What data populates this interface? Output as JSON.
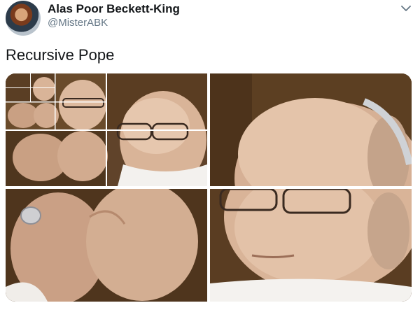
{
  "tweet": {
    "display_name": "Alas Poor Beckett-King",
    "handle": "@MisterABK",
    "text": "Recursive Pope",
    "menu_icon": "chevron-down-icon"
  },
  "media": {
    "layout": "2x2-grid",
    "images": [
      "pope-grid-recursive",
      "pope-face-closeup",
      "pope-hands-ring",
      "pope-face-eyes-closed"
    ]
  },
  "colors": {
    "background": "#ffffff",
    "text": "#14171a",
    "secondary_text": "#657786"
  }
}
